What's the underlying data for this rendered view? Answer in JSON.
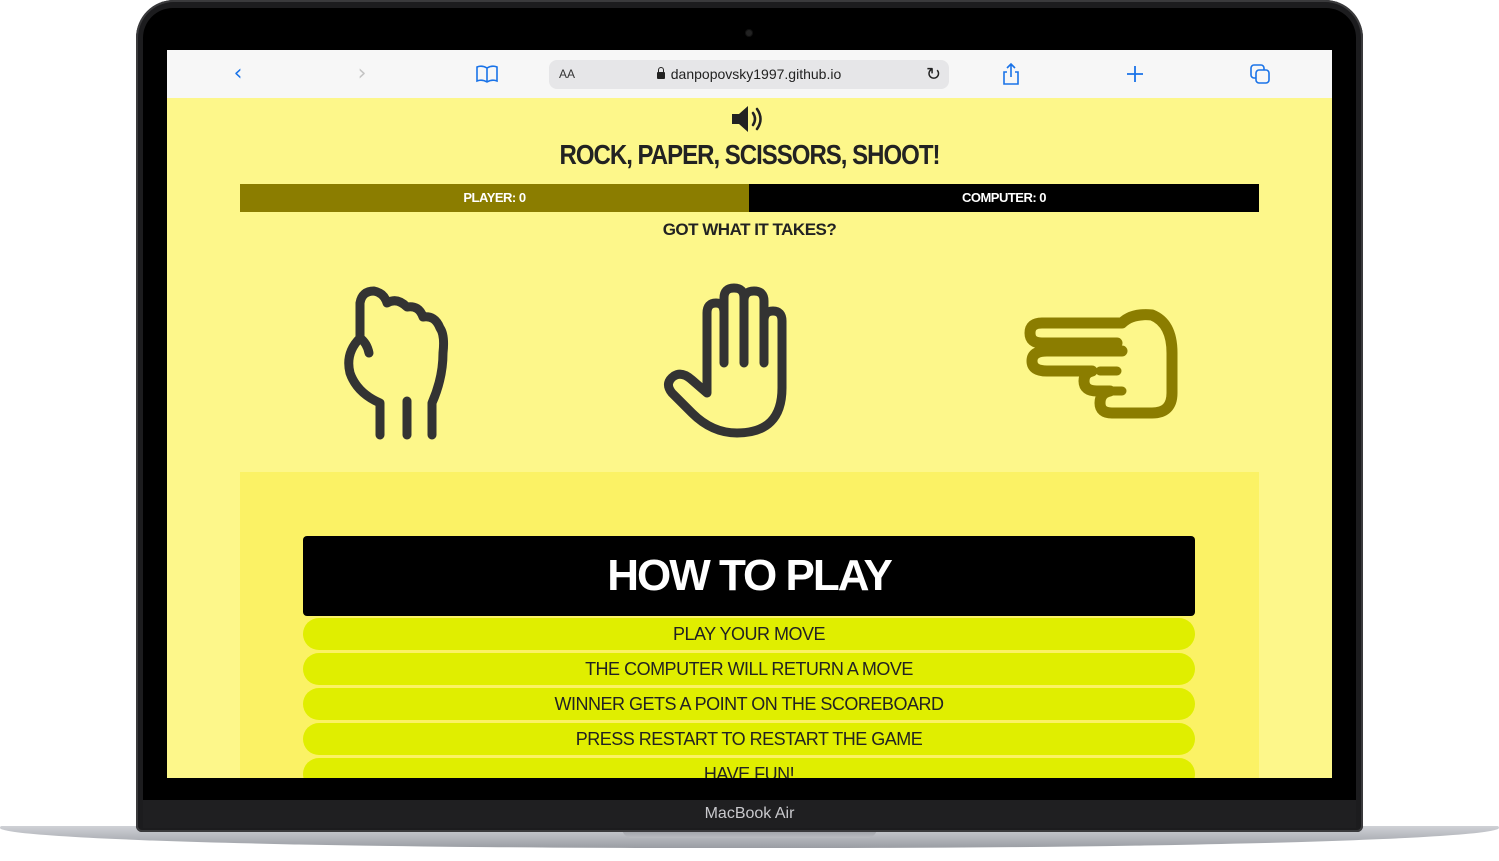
{
  "device": {
    "label": "MacBook Air"
  },
  "browser": {
    "address_size_label": "AA",
    "url": "danpopovsky1997.github.io",
    "icons": [
      "back-icon",
      "forward-icon",
      "bookmarks-icon",
      "reload-icon",
      "share-icon",
      "new-tab-icon",
      "tabs-icon"
    ]
  },
  "game": {
    "sound_icon": "speaker-icon",
    "title": "ROCK, PAPER, SCISSORS, SHOOT!",
    "score": {
      "player": "PLAYER: 0",
      "computer": "COMPUTER: 0"
    },
    "tagline": "GOT WHAT IT TAKES?",
    "moves": [
      {
        "name": "rock",
        "icon": "fist-icon",
        "color": "#333333"
      },
      {
        "name": "paper",
        "icon": "open-hand-icon",
        "color": "#333333"
      },
      {
        "name": "scissors",
        "icon": "scissors-hand-icon",
        "color": "#8b7d00"
      }
    ],
    "how_to_play": {
      "heading": "HOW TO PLAY",
      "steps": [
        "PLAY YOUR MOVE",
        "THE COMPUTER WILL RETURN A MOVE",
        "WINNER GETS A POINT ON THE SCOREBOARD",
        "PRESS RESTART TO RESTART THE GAME",
        "HAVE FUN!"
      ]
    },
    "colors": {
      "background": "#fdf78a",
      "player_bar": "#8b7d00",
      "computer_bar": "#000000",
      "step_bg": "#e0ee00"
    }
  }
}
